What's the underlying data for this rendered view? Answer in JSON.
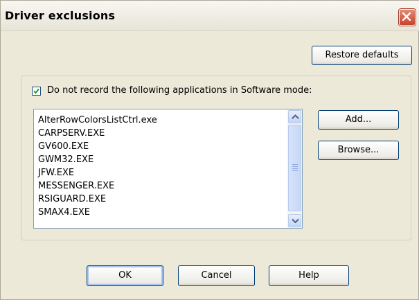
{
  "window": {
    "title": "Driver exclusions",
    "close_icon": "close-x-icon"
  },
  "toolbar": {
    "restore_label": "Restore defaults"
  },
  "exclusions": {
    "checkbox_label": "Do not record the following applications in Software mode:",
    "checked": true,
    "items": [
      "AlterRowColorsListCtrl.exe",
      "CARPSERV.EXE",
      "GV600.EXE",
      "GWM32.EXE",
      "JFW.EXE",
      "MESSENGER.EXE",
      "RSIGUARD.EXE",
      "SMAX4.EXE"
    ],
    "add_label": "Add...",
    "browse_label": "Browse..."
  },
  "buttons": {
    "ok": "OK",
    "cancel": "Cancel",
    "help": "Help"
  },
  "colors": {
    "dialog_bg": "#ece9d8",
    "close_red": "#c6432a",
    "check_green": "#21a121",
    "button_border": "#003c74"
  }
}
